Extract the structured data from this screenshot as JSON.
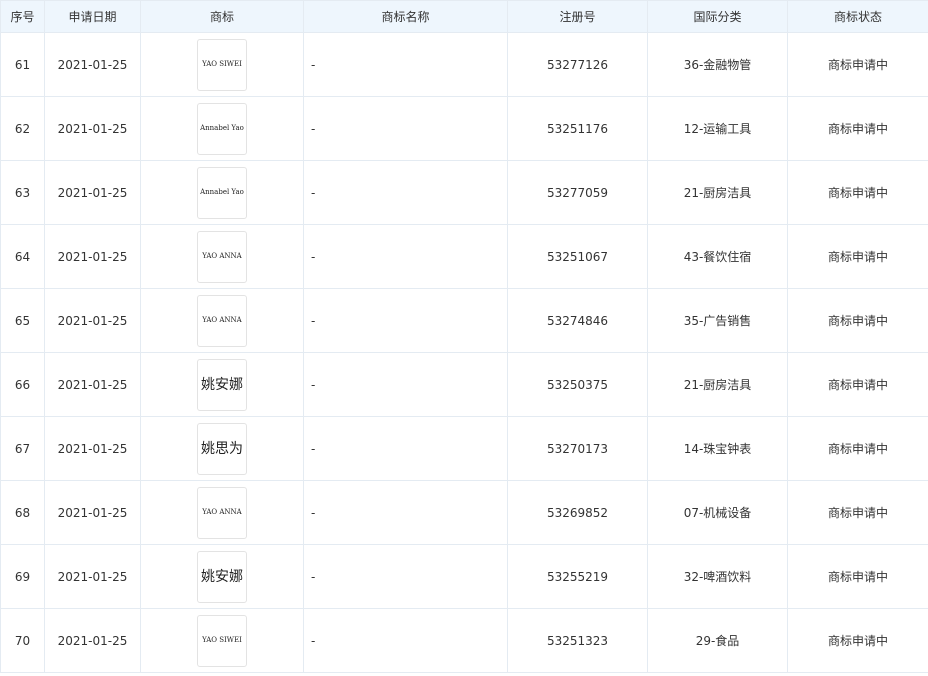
{
  "table": {
    "headers": [
      "序号",
      "申请日期",
      "商标",
      "商标名称",
      "注册号",
      "国际分类",
      "商标状态"
    ],
    "rows": [
      {
        "no": "61",
        "date": "2021-01-25",
        "logo": "YAO SIWEI",
        "logo_script": "latin",
        "name": "-",
        "reg_no": "53277126",
        "class": "36-金融物管",
        "status": "商标申请中"
      },
      {
        "no": "62",
        "date": "2021-01-25",
        "logo": "Annabel Yao",
        "logo_script": "latin",
        "name": "-",
        "reg_no": "53251176",
        "class": "12-运输工具",
        "status": "商标申请中"
      },
      {
        "no": "63",
        "date": "2021-01-25",
        "logo": "Annabel Yao",
        "logo_script": "latin",
        "name": "-",
        "reg_no": "53277059",
        "class": "21-厨房洁具",
        "status": "商标申请中"
      },
      {
        "no": "64",
        "date": "2021-01-25",
        "logo": "YAO ANNA",
        "logo_script": "latin",
        "name": "-",
        "reg_no": "53251067",
        "class": "43-餐饮住宿",
        "status": "商标申请中"
      },
      {
        "no": "65",
        "date": "2021-01-25",
        "logo": "YAO ANNA",
        "logo_script": "latin",
        "name": "-",
        "reg_no": "53274846",
        "class": "35-广告销售",
        "status": "商标申请中"
      },
      {
        "no": "66",
        "date": "2021-01-25",
        "logo": "姚安娜",
        "logo_script": "cjk",
        "name": "-",
        "reg_no": "53250375",
        "class": "21-厨房洁具",
        "status": "商标申请中"
      },
      {
        "no": "67",
        "date": "2021-01-25",
        "logo": "姚思为",
        "logo_script": "cjk",
        "name": "-",
        "reg_no": "53270173",
        "class": "14-珠宝钟表",
        "status": "商标申请中"
      },
      {
        "no": "68",
        "date": "2021-01-25",
        "logo": "YAO ANNA",
        "logo_script": "latin",
        "name": "-",
        "reg_no": "53269852",
        "class": "07-机械设备",
        "status": "商标申请中"
      },
      {
        "no": "69",
        "date": "2021-01-25",
        "logo": "姚安娜",
        "logo_script": "cjk",
        "name": "-",
        "reg_no": "53255219",
        "class": "32-啤酒饮料",
        "status": "商标申请中"
      },
      {
        "no": "70",
        "date": "2021-01-25",
        "logo": "YAO SIWEI",
        "logo_script": "latin",
        "name": "-",
        "reg_no": "53251323",
        "class": "29-食品",
        "status": "商标申请中"
      }
    ]
  }
}
